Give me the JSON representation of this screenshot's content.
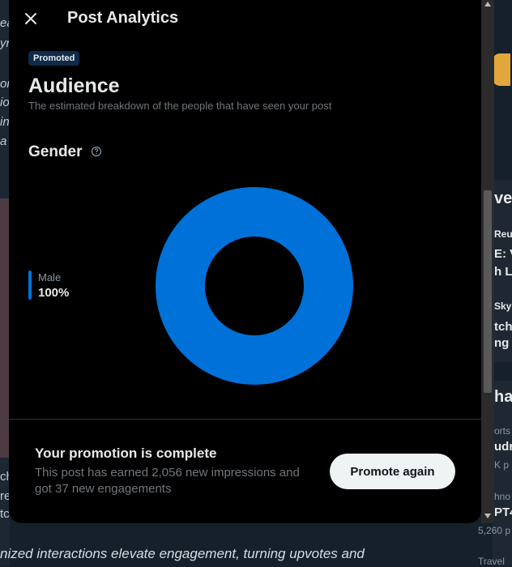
{
  "background": {
    "bottom_text": "nized interactions elevate engagement, turning upvotes and",
    "left_fragments": [
      "ea",
      "yn",
      "or",
      "io",
      "in",
      "a s",
      "ch",
      "re",
      "tc"
    ],
    "right_fragments": [
      "ve",
      "Reu",
      "E: V",
      "h L",
      "Sky",
      "tch",
      "ng",
      "ha",
      "orts",
      "udr",
      "K p",
      "hno",
      "PT4",
      "5,260 p",
      "Travel"
    ]
  },
  "modal": {
    "title": "Post Analytics",
    "badge": "Promoted",
    "section_title": "Audience",
    "section_desc": "The estimated breakdown of the people that have seen your post",
    "gender_title": "Gender",
    "promo_title": "Your promotion is complete",
    "promo_desc": "This post has earned 2,056 new impressions and got 37 new engagements",
    "promo_button": "Promote again"
  },
  "chart_data": {
    "type": "pie",
    "categories": [
      "Male"
    ],
    "values": [
      100
    ],
    "labels": [
      "100%"
    ],
    "colors": [
      "#0071d8"
    ]
  }
}
